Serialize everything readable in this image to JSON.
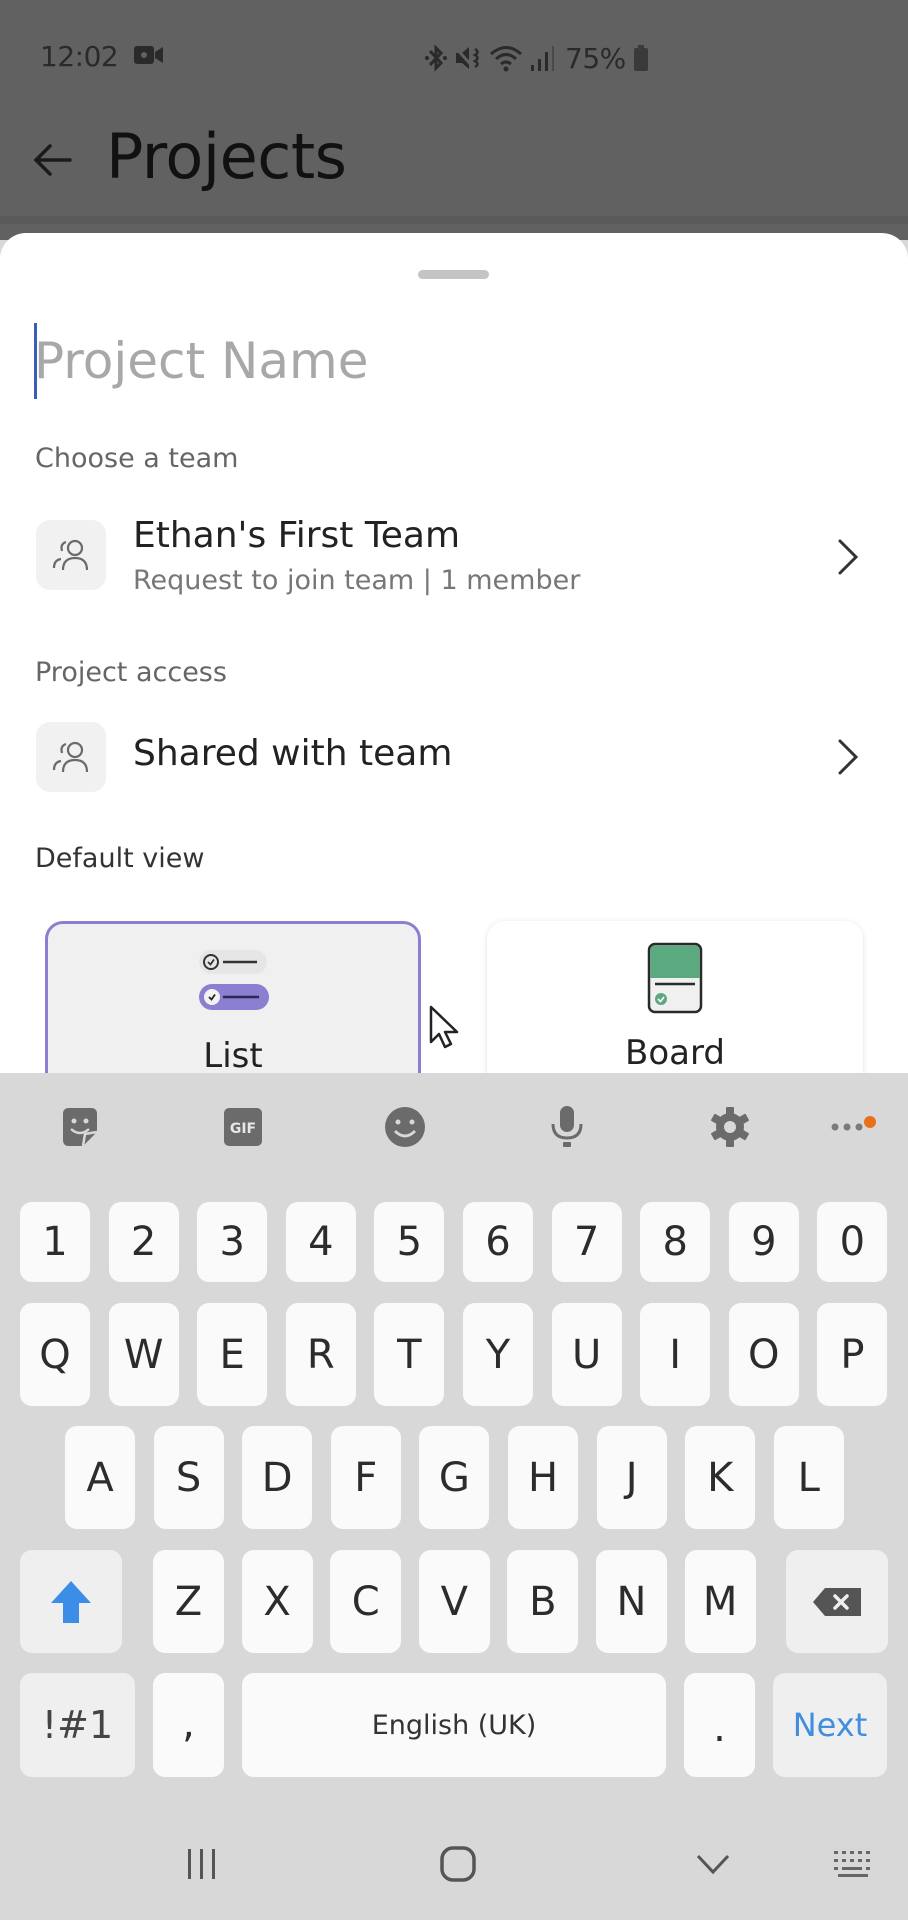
{
  "status_bar": {
    "time": "12:02",
    "battery_percent": "75%",
    "icons": [
      "screen-record-icon",
      "bluetooth-icon",
      "mute-vibrate-icon",
      "wifi-icon",
      "signal-icon",
      "battery-icon"
    ]
  },
  "app_bar": {
    "title": "Projects",
    "back_icon": "arrow-left-icon"
  },
  "sheet": {
    "project_name": {
      "value": "",
      "placeholder": "Project Name"
    },
    "team_section": {
      "label": "Choose a team",
      "team_name": "Ethan's First Team",
      "team_subtitle": "Request to join team | 1 member",
      "icon": "people-icon"
    },
    "access_section": {
      "label": "Project access",
      "value": "Shared with team",
      "icon": "people-icon"
    },
    "view_section": {
      "label": "Default view",
      "options": [
        {
          "label": "List",
          "selected": true,
          "icon": "list-view-icon"
        },
        {
          "label": "Board",
          "selected": false,
          "icon": "board-view-icon"
        }
      ]
    }
  },
  "keyboard": {
    "toolbar": [
      "sticker-icon",
      "gif-icon",
      "emoji-icon",
      "microphone-icon",
      "settings-icon",
      "more-icon"
    ],
    "gif_label": "GIF",
    "rows": [
      [
        "1",
        "2",
        "3",
        "4",
        "5",
        "6",
        "7",
        "8",
        "9",
        "0"
      ],
      [
        "Q",
        "W",
        "E",
        "R",
        "T",
        "Y",
        "U",
        "I",
        "O",
        "P"
      ],
      [
        "A",
        "S",
        "D",
        "F",
        "G",
        "H",
        "J",
        "K",
        "L"
      ],
      [
        "Z",
        "X",
        "C",
        "V",
        "B",
        "N",
        "M"
      ]
    ],
    "symbols_key": "!#1",
    "comma_key": ",",
    "space_label": "English (UK)",
    "period_key": ".",
    "action_key": "Next"
  },
  "colors": {
    "accent_purple": "#8a7fd0",
    "board_green": "#5ba97e",
    "next_blue": "#3f8ee0",
    "shift_blue": "#3b8de8",
    "notification_orange": "#e8701a"
  },
  "nav_bar": [
    "recent-apps-icon",
    "home-icon",
    "hide-keyboard-icon",
    "keyboard-switch-icon"
  ]
}
